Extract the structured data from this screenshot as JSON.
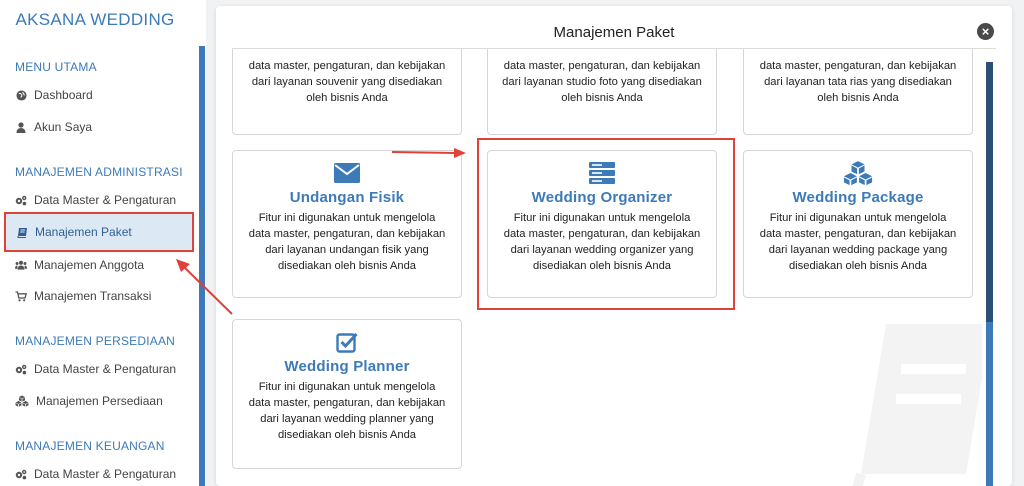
{
  "sidebar": {
    "brand": "AKSANA WEDDING",
    "sections": [
      {
        "title": "MENU UTAMA"
      },
      {
        "title": "MANAJEMEN ADMINISTRASI"
      },
      {
        "title": "MANAJEMEN PERSEDIAAN"
      },
      {
        "title": "MANAJEMEN KEUANGAN"
      }
    ],
    "items": [
      {
        "label": "Dashboard",
        "icon": "globe-icon"
      },
      {
        "label": "Akun Saya",
        "icon": "user-icon"
      },
      {
        "label": "Data Master & Pengaturan",
        "icon": "cogs-icon"
      },
      {
        "label": "Manajemen Paket",
        "icon": "book-icon"
      },
      {
        "label": "Manajemen Anggota",
        "icon": "users-icon"
      },
      {
        "label": "Manajemen Transaksi",
        "icon": "cart-icon"
      },
      {
        "label": "Data Master & Pengaturan",
        "icon": "cogs-icon"
      },
      {
        "label": "Manajemen Persediaan",
        "icon": "cubes-icon"
      },
      {
        "label": "Data Master & Pengaturan",
        "icon": "cogs-icon"
      }
    ]
  },
  "modal": {
    "title": "Manajemen Paket",
    "close": "×",
    "top_cards": [
      {
        "desc": "data master, pengaturan, dan kebijakan dari layanan souvenir yang disediakan oleh bisnis Anda"
      },
      {
        "desc": "data master, pengaturan, dan kebijakan dari layanan studio foto yang disediakan oleh bisnis Anda"
      },
      {
        "desc": "data master, pengaturan, dan kebijakan dari layanan tata rias yang disediakan oleh bisnis Anda"
      }
    ],
    "cards": [
      {
        "title": "Undangan Fisik",
        "icon": "envelope-icon",
        "desc": "Fitur ini digunakan untuk mengelola data master, pengaturan, dan kebijakan dari layanan undangan fisik yang disediakan oleh bisnis Anda"
      },
      {
        "title": "Wedding Organizer",
        "icon": "server-icon",
        "desc": "Fitur ini digunakan untuk mengelola data master, pengaturan, dan kebijakan dari layanan wedding organizer yang disediakan oleh bisnis Anda"
      },
      {
        "title": "Wedding Package",
        "icon": "cubes-icon",
        "desc": "Fitur ini digunakan untuk mengelola data master, pengaturan, dan kebijakan dari layanan wedding package yang disediakan oleh bisnis Anda"
      },
      {
        "title": "Wedding Planner",
        "icon": "check-square-icon",
        "desc": "Fitur ini digunakan untuk mengelola data master, pengaturan, dan kebijakan dari layanan wedding planner yang disediakan oleh bisnis Anda"
      }
    ]
  },
  "colors": {
    "accent": "#3d7ab8",
    "highlight": "#e0413a",
    "active_bg": "#dce9f5"
  }
}
